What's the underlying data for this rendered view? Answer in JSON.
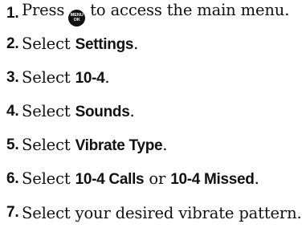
{
  "steps": [
    {
      "number": "1.",
      "segments": [
        {
          "text": "Press",
          "bold": false
        },
        {
          "icon": "menu-ok-key-icon",
          "lines": [
            "MENU",
            "OK"
          ]
        },
        {
          "text": "to access the main menu.",
          "bold": false
        }
      ]
    },
    {
      "number": "2.",
      "segments": [
        {
          "text": "Select ",
          "bold": false
        },
        {
          "text": "Settings",
          "bold": true
        },
        {
          "text": ".",
          "bold": false
        }
      ]
    },
    {
      "number": "3.",
      "segments": [
        {
          "text": "Select ",
          "bold": false
        },
        {
          "text": "10-4",
          "bold": true
        },
        {
          "text": ".",
          "bold": false
        }
      ]
    },
    {
      "number": "4.",
      "segments": [
        {
          "text": "Select ",
          "bold": false
        },
        {
          "text": "Sounds",
          "bold": true
        },
        {
          "text": ".",
          "bold": false
        }
      ]
    },
    {
      "number": "5.",
      "segments": [
        {
          "text": "Select ",
          "bold": false
        },
        {
          "text": "Vibrate Type",
          "bold": true
        },
        {
          "text": ".",
          "bold": false
        }
      ]
    },
    {
      "number": "6.",
      "segments": [
        {
          "text": "Select ",
          "bold": false
        },
        {
          "text": "10-4 Calls",
          "bold": true
        },
        {
          "text": " or ",
          "bold": false
        },
        {
          "text": "10-4 Missed",
          "bold": true
        },
        {
          "text": ".",
          "bold": false
        }
      ]
    },
    {
      "number": "7.",
      "segments": [
        {
          "text": "Select your desired vibrate pattern.",
          "bold": false
        }
      ]
    }
  ]
}
